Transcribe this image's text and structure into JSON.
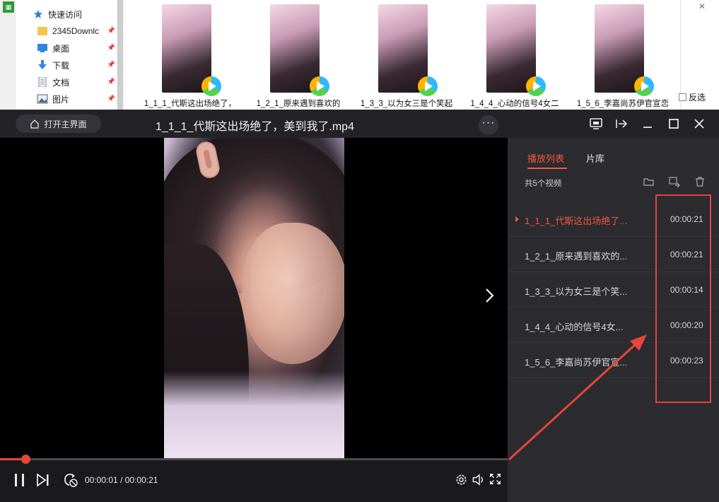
{
  "explorer": {
    "nav": {
      "quick_access": "快速访问",
      "items": [
        {
          "label": "2345Downlc",
          "icon": "folder-icon"
        },
        {
          "label": "桌面",
          "icon": "desktop-icon"
        },
        {
          "label": "下载",
          "icon": "download-icon"
        },
        {
          "label": "文档",
          "icon": "documents-icon"
        },
        {
          "label": "图片",
          "icon": "pictures-icon"
        }
      ],
      "pin_glyph": "📌"
    },
    "files": [
      {
        "caption": "1_1_1_代斯这出场绝了，"
      },
      {
        "caption": "1_2_1_原来遇到喜欢的"
      },
      {
        "caption": "1_3_3_以为女三是个笑起"
      },
      {
        "caption": "1_4_4_心动的信号4女二"
      },
      {
        "caption": "1_5_6_李嘉尚苏伊官宣恋"
      }
    ],
    "invert_select": "反选",
    "close_glyph": "×"
  },
  "player": {
    "home_button": "打开主界面",
    "title": "1_1_1_代斯这出场绝了，美到我了.mp4",
    "more_glyph": "···",
    "progress_fraction": 0.05,
    "time_current": "00:00:01",
    "time_separator": "/",
    "time_total": "00:00:21",
    "accent_color": "#e8453c"
  },
  "playlist": {
    "tabs": [
      {
        "label": "播放列表",
        "active": true
      },
      {
        "label": "片库",
        "active": false
      }
    ],
    "count_text": "共5个视频",
    "items": [
      {
        "name": "1_1_1_代斯这出场绝了...",
        "duration": "00:00:21",
        "active": true
      },
      {
        "name": "1_2_1_原来遇到喜欢的...",
        "duration": "00:00:21",
        "active": false
      },
      {
        "name": "1_3_3_以为女三是个笑...",
        "duration": "00:00:14",
        "active": false
      },
      {
        "name": "1_4_4_心动的信号4女...",
        "duration": "00:00:20",
        "active": false
      },
      {
        "name": "1_5_6_李嘉尚苏伊官宣...",
        "duration": "00:00:23",
        "active": false
      }
    ],
    "active_color": "#f05a3c"
  }
}
